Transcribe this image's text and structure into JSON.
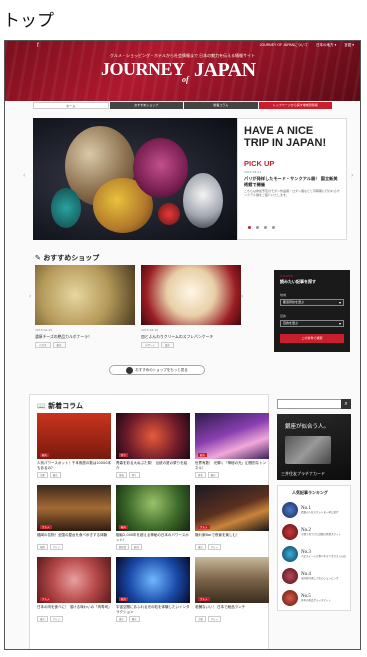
{
  "page_caption": "トップ",
  "header": {
    "social": "f",
    "tagline": "グルメ・ショッピング・ホテルから社会情報まで 日本の魅力を伝える情報サイト",
    "top_links": [
      "JOURNEY OF JAPANについて",
      "日本の地方 ▾",
      "言語 ▾"
    ],
    "logo_part1": "JOURNEY",
    "logo_of": "of",
    "logo_part2": "JAPAN"
  },
  "nav": {
    "items": [
      "ホーム",
      "おすすめショップ",
      "新着コラム",
      "トップページから探す地域別情報"
    ]
  },
  "hero": {
    "heading": "HAVE A NICE TRIP IN JAPAN!",
    "pick_label": "PICK UP",
    "date": "2015.04.24",
    "title": "パリが発祥したモード・サンクアル展！ 国立新美術館で開催",
    "text": "こちらは参加予定のモダン作品展・ロダン展などと同時期に行われるサンクアル展をご紹介いたします。",
    "prev": "‹",
    "next": "›",
    "slides": 4,
    "active_slide": 1
  },
  "shop": {
    "title": "おすすめショップ",
    "cards": [
      {
        "date": "2015.04.22",
        "name": "濃厚チーズの絶品カルボナーラ！",
        "tags": [
          "パスタ",
          "東京"
        ]
      },
      {
        "date": "2015.04.16",
        "name": "皿とふんわりクリームのスフレパンケーキ",
        "tags": [
          "デザート",
          "東京"
        ]
      }
    ],
    "more_label": "おすすめのショップをもっと見る",
    "prev": "‹",
    "next": "›"
  },
  "finder": {
    "header": "COLUMN",
    "title": "読みたい記事を探す",
    "area_label": "地域",
    "area_value": "都道府県を選ぶ",
    "category_label": "目的",
    "category_value": "目的を選ぶ",
    "submit": "この条件で検索"
  },
  "columns": {
    "title": "新着コラム",
    "items": [
      {
        "tag": "観光",
        "name": "人気パワースポット！千本鳥居の数は10000本もあるの?",
        "tags": [
          "京都",
          "観光"
        ]
      },
      {
        "tag": "祭り",
        "name": "青森を彩る大ねぶた祭！ 伝統の夏の祭りを紹介",
        "tags": [
          "青森",
          "祭り"
        ]
      },
      {
        "tag": "観光",
        "name": "世界有数！ 光輝く『神秘の光』幻想的なトンネル！",
        "tags": [
          "栃木",
          "観光"
        ]
      },
      {
        "tag": "グルメ",
        "name": "福岡の名物！全国の屋台を食べ歩きする体験",
        "tags": [
          "福岡",
          "グルメ"
        ]
      },
      {
        "tag": "観光",
        "name": "樹齢2,000年を超える神秘の日本のパワースポット！",
        "tags": [
          "鹿児島",
          "観光"
        ]
      },
      {
        "tag": "グルメ",
        "name": "隠れ家Barで夜景を楽しむ！",
        "tags": [
          "東京",
          "グルメ"
        ]
      },
      {
        "tag": "グルメ",
        "name": "日本の肉を食べに！ 溶ける味わいの『肉寿司』",
        "tags": [
          "東京",
          "グルメ"
        ]
      },
      {
        "tag": "観光",
        "name": "宇宙空間にあふれる光の粒を体験したいインタラクション",
        "tags": [
          "東京",
          "観光"
        ]
      },
      {
        "tag": "グルメ",
        "name": "老舗ないい！ 日本で絶品ランチ",
        "tags": [
          "大阪",
          "グルメ"
        ]
      }
    ]
  },
  "sidebar": {
    "search_icon": "search-icon",
    "ad_title": "銀座が似合う人。",
    "ad_caption": "三井住友プラチナカード",
    "ranking_title": "人気記事ランキング",
    "ranking": [
      {
        "no": "No.1",
        "text": "話題の人気スポットを一挙に紹介"
      },
      {
        "no": "No.2",
        "text": "京都で見つけた話題の絶景スポット"
      },
      {
        "no": "No.3",
        "text": "人気スイーツの食べ歩きでオススメの店"
      },
      {
        "no": "No.4",
        "text": "海外旅行者に人気のショッピング"
      },
      {
        "no": "No.5",
        "text": "日本の絶品グルメスポット"
      }
    ]
  },
  "colors": {
    "accent": "#c81f2c",
    "dark": "#1a1a1a"
  }
}
